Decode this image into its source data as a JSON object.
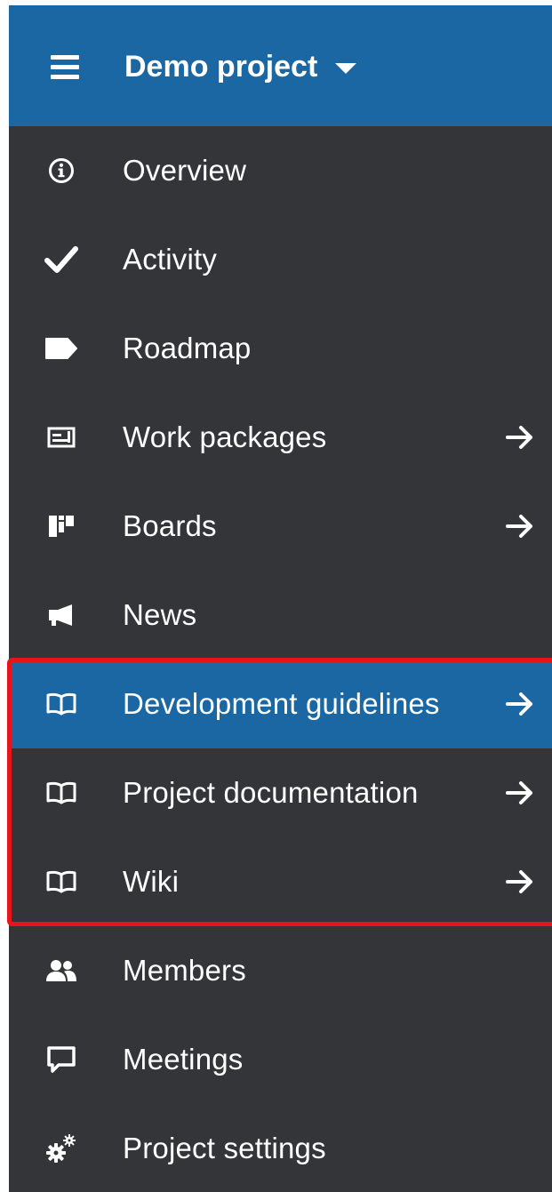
{
  "header": {
    "project_title": "Demo project"
  },
  "menu": {
    "items": [
      {
        "label": "Overview",
        "icon": "info-circle-icon"
      },
      {
        "label": "Activity",
        "icon": "checkmark-icon"
      },
      {
        "label": "Roadmap",
        "icon": "tag-icon"
      },
      {
        "label": "Work packages",
        "icon": "work-packages-icon",
        "has_arrow": true
      },
      {
        "label": "Boards",
        "icon": "boards-icon",
        "has_arrow": true
      },
      {
        "label": "News",
        "icon": "megaphone-icon"
      },
      {
        "label": "Development guidelines",
        "icon": "book-icon",
        "has_arrow": true,
        "active": true
      },
      {
        "label": "Project documentation",
        "icon": "book-icon",
        "has_arrow": true
      },
      {
        "label": "Wiki",
        "icon": "book-icon",
        "has_arrow": true
      },
      {
        "label": "Members",
        "icon": "members-icon"
      },
      {
        "label": "Meetings",
        "icon": "speech-bubble-icon"
      },
      {
        "label": "Project settings",
        "icon": "gears-icon"
      }
    ]
  },
  "colors": {
    "header_bg": "#1a67a3",
    "sidebar_bg": "#333538",
    "active_bg": "#1a67a3",
    "highlight_border": "#e8141b",
    "text": "#ffffff"
  }
}
